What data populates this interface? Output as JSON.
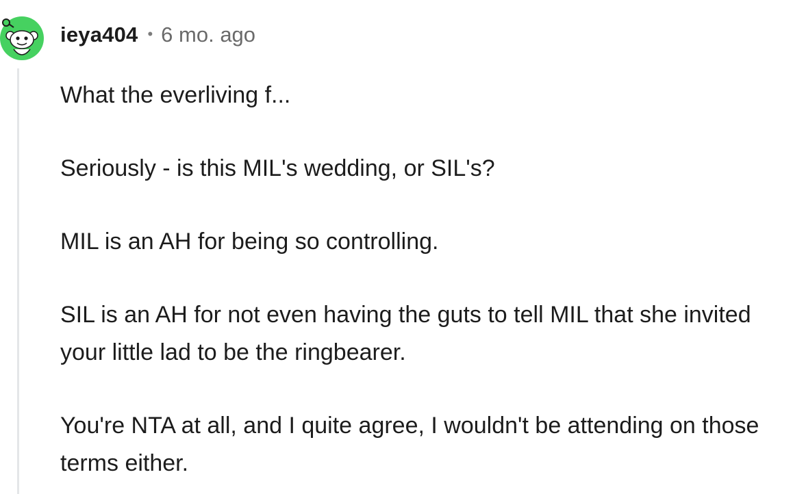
{
  "comment": {
    "username": "ieya404",
    "separator": "•",
    "timestamp": "6 mo. ago",
    "avatar_color": "#46d160",
    "paragraphs": [
      "What the everliving f...",
      "Seriously - is this MIL's wedding, or SIL's?",
      "MIL is an AH for being so controlling.",
      "SIL is an AH for not even having the guts to tell MIL that she invited your little lad to be the ringbearer.",
      "You're NTA at all, and I quite agree, I wouldn't be attending on those terms either."
    ]
  }
}
